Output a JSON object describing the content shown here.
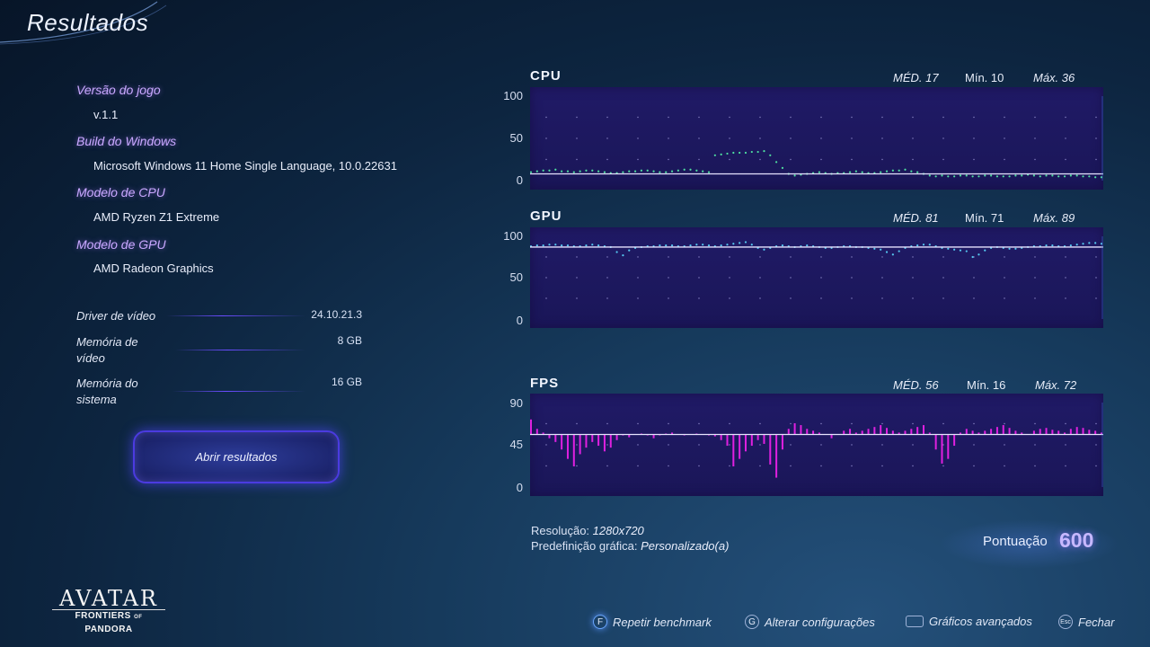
{
  "page": {
    "title": "Resultados"
  },
  "info": [
    {
      "label": "Versão do jogo",
      "value": "v.1.1"
    },
    {
      "label": "Build do Windows",
      "value": "Microsoft Windows 11 Home Single Language, 10.0.22631"
    },
    {
      "label": "Modelo de CPU",
      "value": "AMD Ryzen Z1 Extreme"
    },
    {
      "label": "Modelo de GPU",
      "value": "AMD Radeon Graphics"
    }
  ],
  "specs": [
    {
      "label": "Driver de vídeo",
      "value": "24.10.21.3"
    },
    {
      "label": "Memória de vídeo",
      "value": "8 GB"
    },
    {
      "label": "Memória do sistema",
      "value": "16 GB"
    }
  ],
  "open_button": "Abrir resultados",
  "charts": {
    "cpu": {
      "name": "CPU",
      "avg": "MÉD. 17",
      "min": "Mín. 10",
      "max": "Máx. 36",
      "ticks": [
        "100",
        "50",
        "0"
      ]
    },
    "gpu": {
      "name": "GPU",
      "avg": "MÉD. 81",
      "min": "Mín. 71",
      "max": "Máx. 89",
      "ticks": [
        "100",
        "50",
        "0"
      ]
    },
    "fps": {
      "name": "FPS",
      "avg": "MÉD. 56",
      "min": "Mín. 16",
      "max": "Máx. 72",
      "ticks": [
        "90",
        "45",
        "0"
      ]
    }
  },
  "chart_data": [
    {
      "type": "scatter",
      "title": "CPU",
      "ylim": [
        0,
        100
      ],
      "average_line": 8,
      "color": "#4fe0a0",
      "values": [
        10,
        11,
        12,
        12,
        13,
        11,
        11,
        10,
        11,
        12,
        12,
        11,
        10,
        9,
        9,
        10,
        11,
        11,
        12,
        12,
        11,
        10,
        10,
        11,
        12,
        13,
        13,
        12,
        11,
        10,
        30,
        31,
        32,
        33,
        33,
        33,
        34,
        34,
        35,
        30,
        22,
        15,
        8,
        6,
        7,
        8,
        9,
        10,
        9,
        8,
        9,
        9,
        10,
        11,
        10,
        9,
        9,
        10,
        11,
        12,
        12,
        13,
        11,
        10,
        8,
        6,
        5,
        6,
        5,
        5,
        6,
        6,
        5,
        5,
        6,
        6,
        5,
        5,
        5,
        6,
        6,
        7,
        6,
        5,
        6,
        6,
        5,
        5,
        6,
        6,
        5,
        5,
        4,
        4
      ]
    },
    {
      "type": "scatter",
      "title": "GPU",
      "ylim": [
        0,
        100
      ],
      "average_line": 87,
      "color": "#55c8f0",
      "values": [
        88,
        89,
        89,
        90,
        90,
        89,
        89,
        88,
        88,
        89,
        90,
        89,
        88,
        87,
        81,
        77,
        83,
        86,
        87,
        88,
        88,
        89,
        89,
        89,
        88,
        88,
        89,
        90,
        90,
        89,
        88,
        89,
        90,
        91,
        92,
        93,
        90,
        86,
        84,
        86,
        88,
        89,
        88,
        87,
        88,
        89,
        88,
        87,
        86,
        86,
        87,
        88,
        88,
        87,
        87,
        86,
        85,
        84,
        81,
        78,
        82,
        86,
        88,
        89,
        90,
        90,
        88,
        86,
        85,
        84,
        83,
        82,
        75,
        78,
        83,
        86,
        87,
        86,
        85,
        85,
        86,
        87,
        88,
        88,
        89,
        89,
        88,
        88,
        89,
        90,
        91,
        92,
        92,
        91
      ]
    },
    {
      "type": "bar",
      "title": "FPS",
      "ylim": [
        0,
        90
      ],
      "average_line": 56,
      "color": "#e020e0",
      "values": [
        72,
        62,
        58,
        52,
        48,
        40,
        30,
        22,
        35,
        42,
        48,
        44,
        38,
        42,
        50,
        55,
        53,
        56,
        57,
        55,
        52,
        55,
        57,
        58,
        56,
        55,
        56,
        57,
        56,
        55,
        54,
        50,
        44,
        22,
        30,
        38,
        44,
        50,
        46,
        24,
        10,
        40,
        62,
        68,
        66,
        62,
        60,
        58,
        56,
        52,
        56,
        60,
        62,
        58,
        60,
        62,
        64,
        66,
        63,
        60,
        58,
        60,
        62,
        64,
        66,
        58,
        40,
        25,
        30,
        44,
        58,
        62,
        60,
        58,
        60,
        62,
        64,
        66,
        63,
        60,
        58,
        56,
        60,
        62,
        63,
        61,
        60,
        58,
        62,
        64,
        63,
        61,
        60,
        58
      ]
    }
  ],
  "run_info": {
    "resolution_label": "Resolução:",
    "resolution_value": "1280x720",
    "preset_label": "Predefinição gráfica:",
    "preset_value": "Personalizado(a)"
  },
  "score": {
    "label": "Pontuação",
    "value": "600"
  },
  "logo": {
    "line1": "AVATAR",
    "line2": "FRONTIERS",
    "line2b": "OF",
    "line2c": "PANDORA"
  },
  "actions": [
    {
      "key": "F",
      "label": "Repetir benchmark"
    },
    {
      "key": "G",
      "label": "Alterar configurações"
    },
    {
      "key": "",
      "label": "Gráficos avançados"
    },
    {
      "key": "Esc",
      "label": "Fechar"
    }
  ]
}
